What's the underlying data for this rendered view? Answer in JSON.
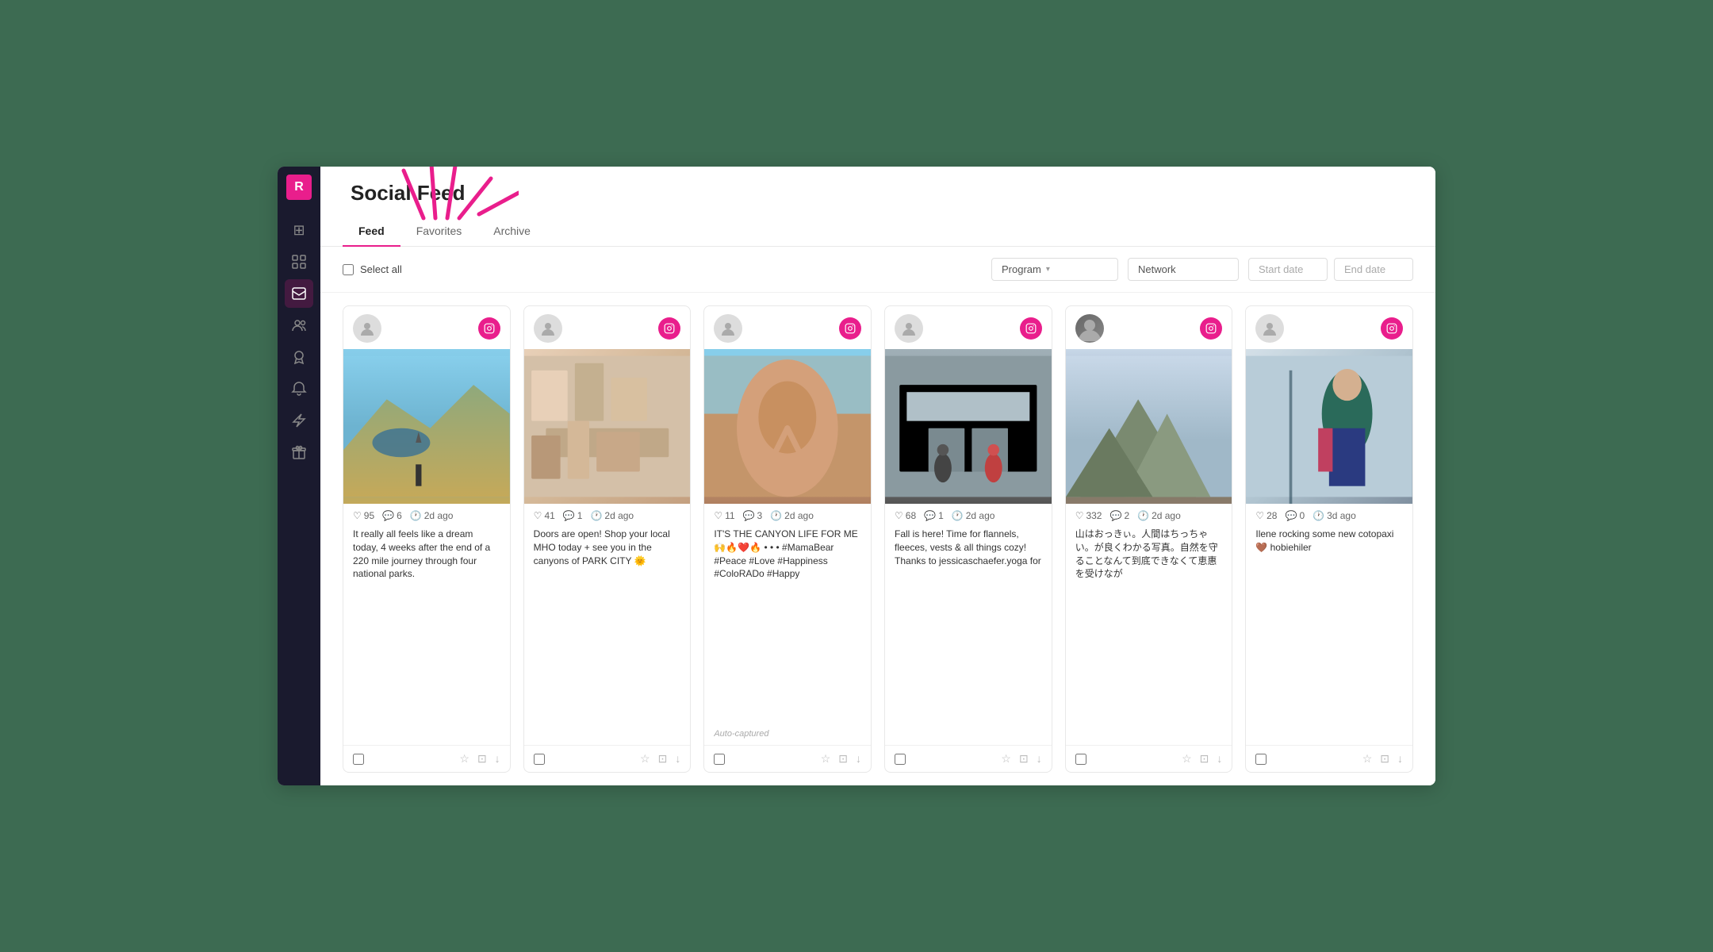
{
  "app": {
    "logo": "R",
    "title": "Social Feed"
  },
  "sidebar": {
    "items": [
      {
        "id": "logo",
        "icon": "R",
        "label": "Logo"
      },
      {
        "id": "grid",
        "icon": "⊞",
        "label": "Dashboard"
      },
      {
        "id": "widgets",
        "icon": "❖",
        "label": "Widgets"
      },
      {
        "id": "social",
        "icon": "📡",
        "label": "Social Feed",
        "active": true
      },
      {
        "id": "people",
        "icon": "👥",
        "label": "People"
      },
      {
        "id": "award",
        "icon": "🏆",
        "label": "Awards"
      },
      {
        "id": "bell",
        "icon": "🔔",
        "label": "Notifications"
      },
      {
        "id": "lightning",
        "icon": "⚡",
        "label": "Quick Actions"
      },
      {
        "id": "gift",
        "icon": "🎁",
        "label": "Gifts"
      }
    ]
  },
  "tabs": [
    {
      "id": "feed",
      "label": "Feed",
      "active": true
    },
    {
      "id": "favorites",
      "label": "Favorites",
      "active": false
    },
    {
      "id": "archive",
      "label": "Archive",
      "active": false
    }
  ],
  "toolbar": {
    "select_all_label": "Select all",
    "program_placeholder": "Program",
    "network_placeholder": "Network",
    "start_date_placeholder": "Start date",
    "end_date_placeholder": "End date"
  },
  "posts": [
    {
      "id": 1,
      "network": "instagram",
      "likes": 95,
      "comments": 6,
      "time_ago": "2d ago",
      "caption": "It really all feels like a dream today, 4 weeks after the end of a 220 mile journey through four national parks.",
      "auto_captured": false,
      "img_type": "mountain"
    },
    {
      "id": 2,
      "network": "instagram",
      "likes": 41,
      "comments": 1,
      "time_ago": "2d ago",
      "caption": "Doors are open! Shop your local MHO today + see you in the canyons of PARK CITY 🌞",
      "auto_captured": false,
      "img_type": "shop"
    },
    {
      "id": 3,
      "network": "instagram",
      "likes": 11,
      "comments": 3,
      "time_ago": "2d ago",
      "caption": "IT'S THE CANYON LIFE FOR ME🙌🔥❤️🔥 • • • #MamaBear #Peace #Love #Happiness #ColoRADo #Happy",
      "auto_captured": true,
      "auto_captured_label": "Auto-captured",
      "img_type": "selfie"
    },
    {
      "id": 4,
      "network": "instagram",
      "likes": 68,
      "comments": 1,
      "time_ago": "2d ago",
      "caption": "Fall is here! Time for flannels, fleeces, vests & all things cozy! Thanks to jessicaschaefer.yoga for",
      "auto_captured": false,
      "img_type": "store"
    },
    {
      "id": 5,
      "network": "instagram",
      "has_avatar": true,
      "likes": 332,
      "comments": 2,
      "time_ago": "2d ago",
      "caption": "山はおっきぃ。人間はちっちゃい。が良くわかる写真。自然を守ることなんて到底できなくて恵惠を受けなが",
      "auto_captured": false,
      "img_type": "peak"
    },
    {
      "id": 6,
      "network": "instagram",
      "likes": 28,
      "comments": 0,
      "time_ago": "3d ago",
      "caption": "Ilene rocking some new cotopaxi 🤎 hobiehiler",
      "auto_captured": false,
      "img_type": "woman"
    }
  ]
}
